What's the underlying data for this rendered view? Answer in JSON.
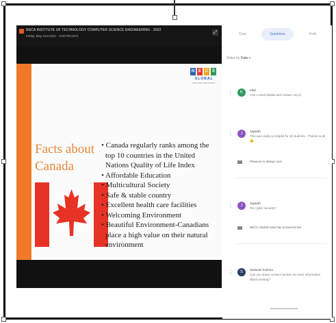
{
  "meeting": {
    "title": "NSCA INSTITUTE OF TECHNOLOGY COMPUTER SCIENCE ENGINEERING · 2022",
    "datetime": "Friday, May 21st 2021 · 3:00 PM (IST)"
  },
  "slide": {
    "logo_letters": [
      "N",
      "E",
      "C",
      "S"
    ],
    "logo_word": "GLOBAL",
    "logo_tagline": "EXPLORE THE WORLD",
    "heading_line1": "Facts about",
    "heading_line2": "Canada",
    "bullets": [
      "Canada regularly ranks among the top 10 countries in the United Nations Quality of Life Index",
      "Affordable Education",
      "Multicultural Society",
      "Safe & stable country",
      "Excellent health care facilities",
      "Welcoming Environment",
      "Beautiful Environment-Canadians place a high value on their natural environment"
    ]
  },
  "panel": {
    "tabs": [
      "Chat",
      "Questions",
      "Polls"
    ],
    "active_tab": "Questions",
    "order_label": "Order by",
    "order_value": "Date",
    "questions": [
      {
        "initial": "K",
        "color": "#2e9a5a",
        "name": "Kitai",
        "text": "Can u send details and contact. No pl"
      },
      {
        "initial": "J",
        "color": "#8e52c4",
        "name": "Jayanth",
        "text": "This was really so helpful for all students.. Thanks to all 😊",
        "reply": "Pleasure is always ours"
      },
      {
        "initial": "J",
        "color": "#8e52c4",
        "name": "Jayanth",
        "text": "Per cyber security?",
        "reply": "NECC Global India has answered live"
      },
      {
        "initial": "S",
        "color": "#2b3d63",
        "name": "Suhasini Krishna",
        "text": "Can you share contact number for more information about nursing?"
      }
    ]
  },
  "colors": {
    "accent_orange": "#f07a2a",
    "flag_red": "#e63325",
    "tab_blue": "#4a6fd3"
  }
}
